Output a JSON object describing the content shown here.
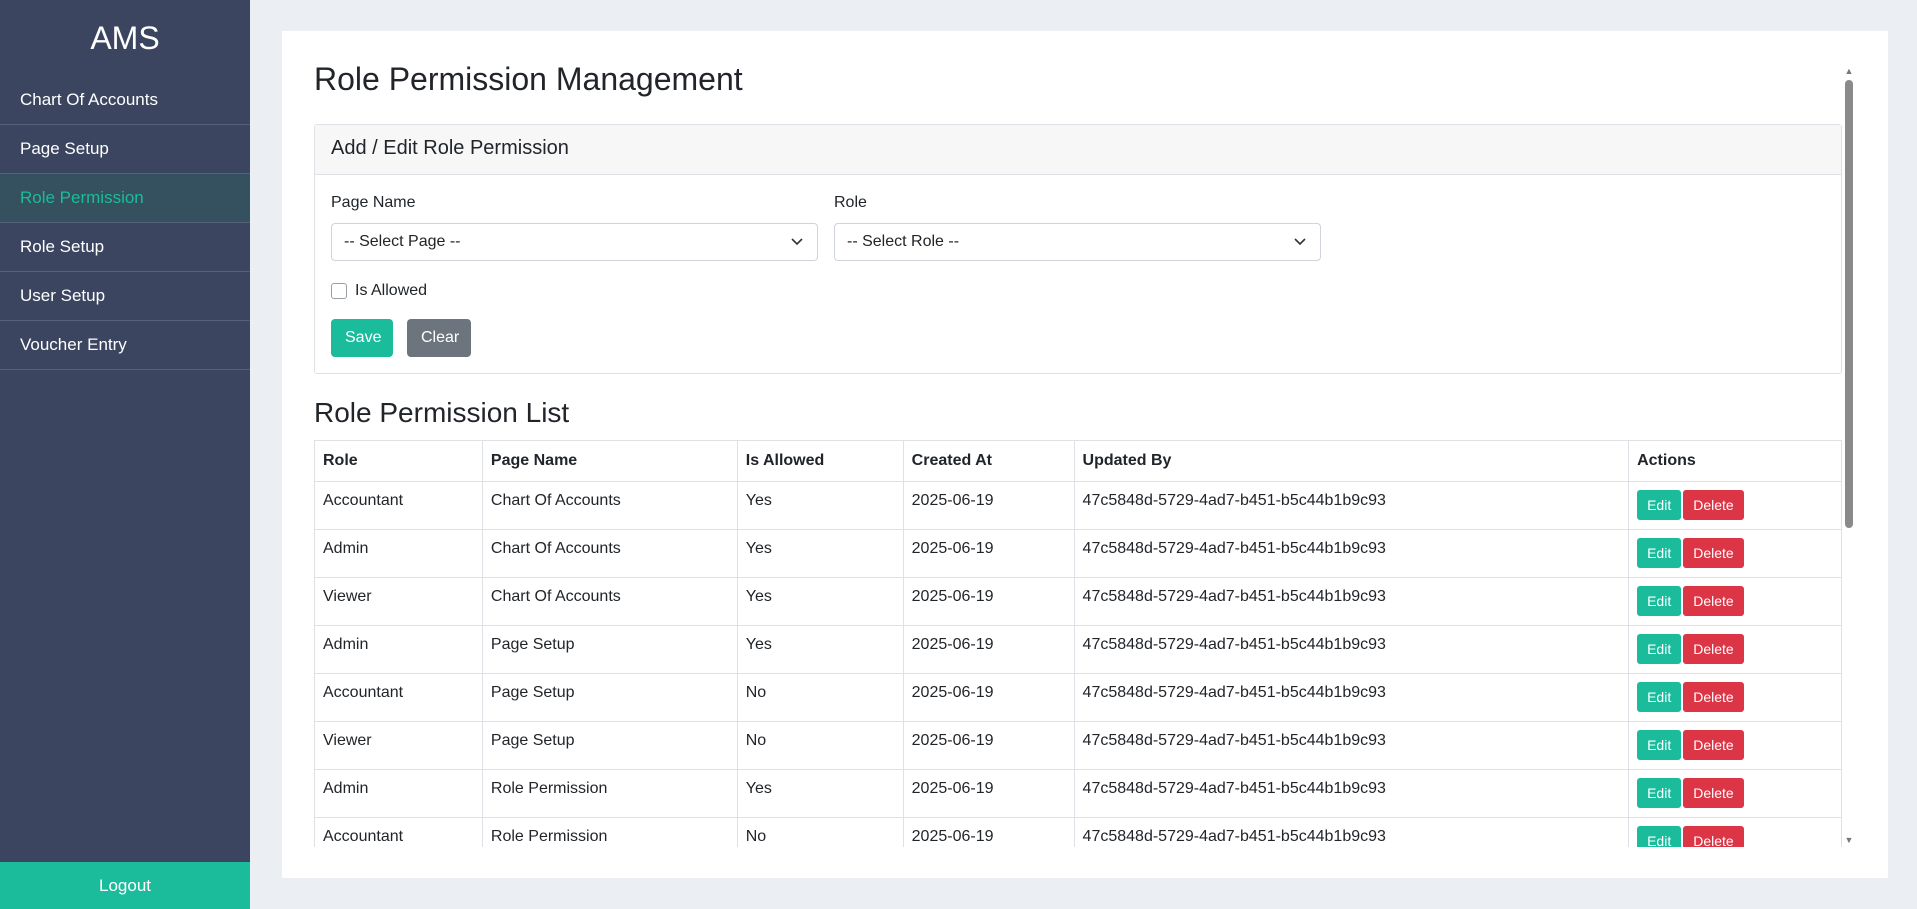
{
  "app": {
    "brand": "AMS"
  },
  "sidebar": {
    "items": [
      {
        "label": "Chart Of Accounts"
      },
      {
        "label": "Page Setup"
      },
      {
        "label": "Role Permission"
      },
      {
        "label": "Role Setup"
      },
      {
        "label": "User Setup"
      },
      {
        "label": "Voucher Entry"
      }
    ],
    "active_index": 2,
    "logout_label": "Logout"
  },
  "page": {
    "title": "Role Permission Management"
  },
  "form": {
    "header": "Add / Edit Role Permission",
    "page_name_label": "Page Name",
    "page_select_value": "-- Select Page --",
    "role_label": "Role",
    "role_select_value": "-- Select Role --",
    "is_allowed_label": "Is Allowed",
    "is_allowed_checked": false,
    "save_label": "Save",
    "clear_label": "Clear"
  },
  "list": {
    "title": "Role Permission List",
    "columns": [
      "Role",
      "Page Name",
      "Is Allowed",
      "Created At",
      "Updated By",
      "Actions"
    ],
    "edit_label": "Edit",
    "delete_label": "Delete",
    "rows": [
      [
        "Accountant",
        "Chart Of Accounts",
        "Yes",
        "2025-06-19",
        "47c5848d-5729-4ad7-b451-b5c44b1b9c93"
      ],
      [
        "Admin",
        "Chart Of Accounts",
        "Yes",
        "2025-06-19",
        "47c5848d-5729-4ad7-b451-b5c44b1b9c93"
      ],
      [
        "Viewer",
        "Chart Of Accounts",
        "Yes",
        "2025-06-19",
        "47c5848d-5729-4ad7-b451-b5c44b1b9c93"
      ],
      [
        "Admin",
        "Page Setup",
        "Yes",
        "2025-06-19",
        "47c5848d-5729-4ad7-b451-b5c44b1b9c93"
      ],
      [
        "Accountant",
        "Page Setup",
        "No",
        "2025-06-19",
        "47c5848d-5729-4ad7-b451-b5c44b1b9c93"
      ],
      [
        "Viewer",
        "Page Setup",
        "No",
        "2025-06-19",
        "47c5848d-5729-4ad7-b451-b5c44b1b9c93"
      ],
      [
        "Admin",
        "Role Permission",
        "Yes",
        "2025-06-19",
        "47c5848d-5729-4ad7-b451-b5c44b1b9c93"
      ],
      [
        "Accountant",
        "Role Permission",
        "No",
        "2025-06-19",
        "47c5848d-5729-4ad7-b451-b5c44b1b9c93"
      ]
    ]
  },
  "icons": {
    "select_chevron": "chevron-down-icon",
    "scroll_up": "scroll-up-arrow-icon",
    "scroll_down": "scroll-down-arrow-icon"
  },
  "colors": {
    "sidebar_bg": "#3b4560",
    "accent": "#1abc9c",
    "danger": "#dc3545",
    "secondary": "#6c757d",
    "page_bg": "#ebeef3"
  }
}
